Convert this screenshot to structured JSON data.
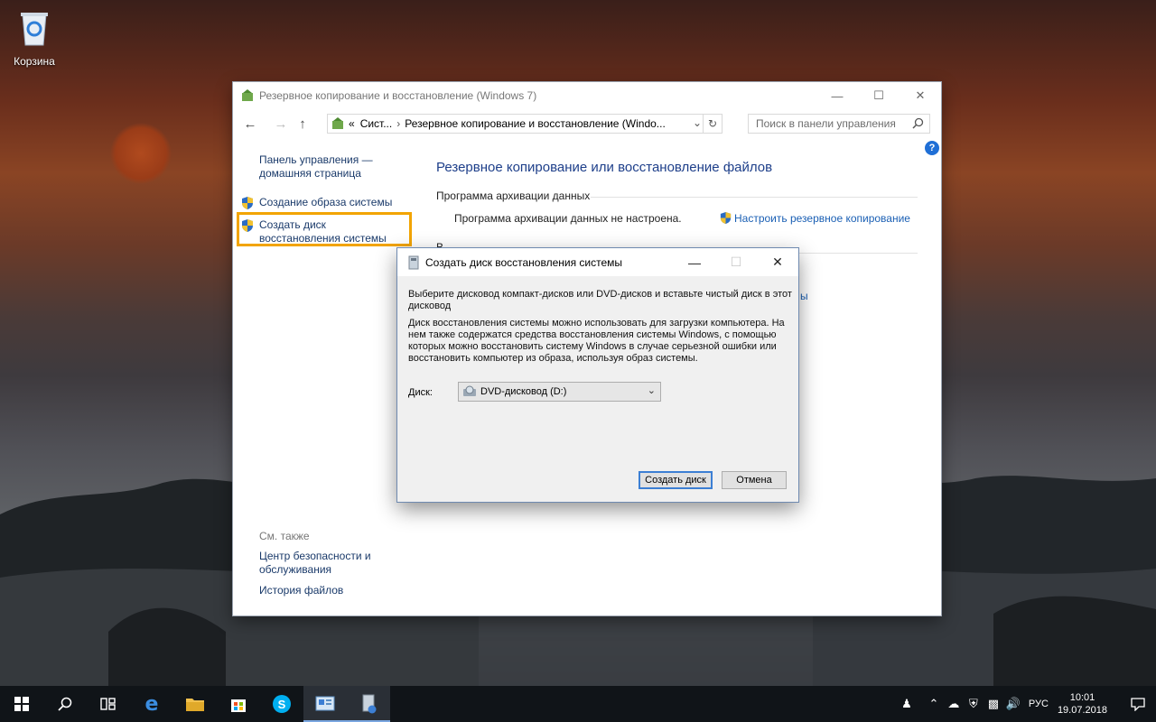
{
  "desktop": {
    "recycle_bin_label": "Корзина"
  },
  "window": {
    "title": "Резервное копирование и восстановление (Windows 7)",
    "address": {
      "crumb_prev": "Сист...",
      "crumb_current": "Резервное копирование и восстановление (Windo..."
    },
    "search_placeholder": "Поиск в панели управления",
    "sidebar": {
      "home_line1": "Панель управления —",
      "home_line2": "домашняя страница",
      "items": [
        {
          "label": "Создание образа системы"
        },
        {
          "label": "Создать диск восстановления системы"
        }
      ],
      "see_also_title": "См. также",
      "see_also": [
        {
          "label": "Центр безопасности и обслуживания"
        },
        {
          "label": "История файлов"
        }
      ]
    },
    "main": {
      "heading": "Резервное копирование или восстановление файлов",
      "section_title": "Программа архивации данных",
      "status_text": "Программа архивации данных не настроена.",
      "setup_link": "Настроить резервное копирование",
      "partial_section": "В",
      "partial_link": "ы"
    }
  },
  "dialog": {
    "title": "Создать диск восстановления системы",
    "instruction": "Выберите дисковод компакт-дисков или DVD-дисков и вставьте чистый диск в этот дисковод",
    "description": "Диск восстановления системы можно использовать для загрузки компьютера. На нем также содержатся средства восстановления системы Windows, с помощью которых можно восстановить систему Windows в случае серьезной ошибки или восстановить компьютер из образа, используя образ системы.",
    "disk_label": "Диск:",
    "disk_value": "DVD-дисковод (D:)",
    "create_button": "Создать диск",
    "cancel_button": "Отмена"
  },
  "taskbar": {
    "apps": [
      "start-icon",
      "search-icon",
      "task-view-icon",
      "edge-icon",
      "file-explorer-icon",
      "store-icon",
      "skype-icon",
      "control-panel-icon",
      "recovery-disk-icon"
    ],
    "language": "РУС",
    "time": "10:01",
    "date": "19.07.2018"
  },
  "colors": {
    "accent": "#f2a400",
    "link": "#1a3a6a",
    "heading": "#1e3f8a",
    "taskbar": "#101418"
  }
}
